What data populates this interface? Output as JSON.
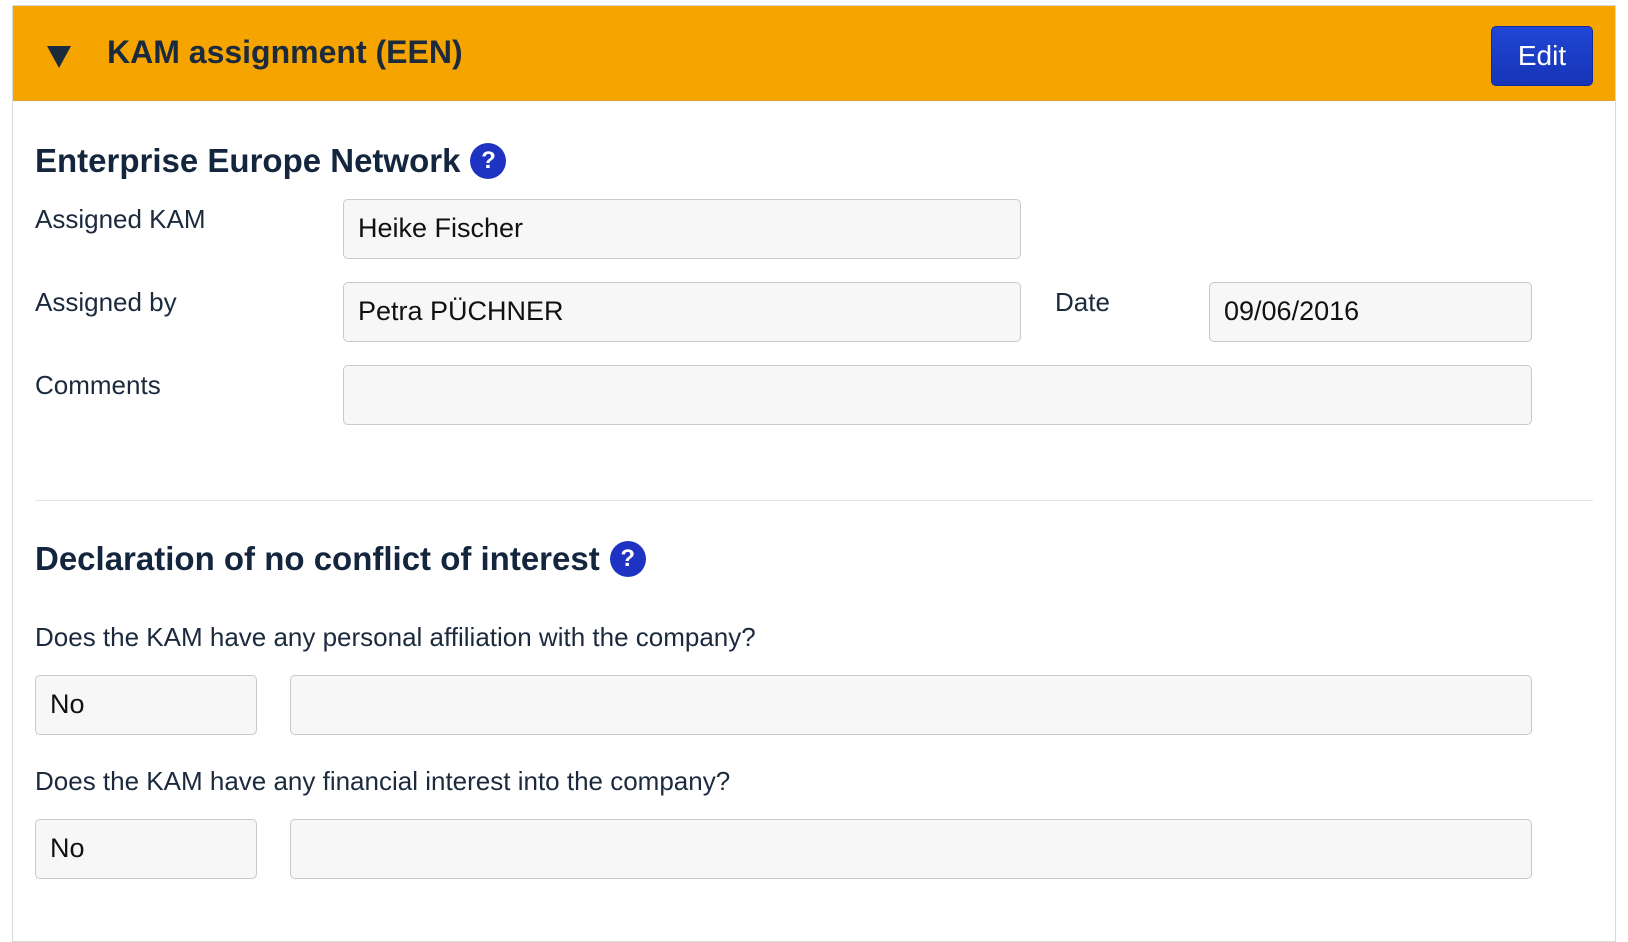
{
  "header": {
    "title": "KAM assignment (EEN)",
    "edit_label": "Edit",
    "color": "#f5a400"
  },
  "een": {
    "title": "Enterprise Europe Network",
    "help": "?",
    "assigned_kam_label": "Assigned KAM",
    "assigned_kam_value": "Heike Fischer",
    "assigned_by_label": "Assigned by",
    "assigned_by_value": "Petra PÜCHNER",
    "date_label": "Date",
    "date_value": "09/06/2016",
    "comments_label": "Comments",
    "comments_value": ""
  },
  "declaration": {
    "title": "Declaration of no conflict of interest",
    "help": "?",
    "q1": "Does the KAM have any personal affiliation with the company?",
    "q1_answer": "No",
    "q1_details": "",
    "q2": "Does the KAM have any financial interest into the company?",
    "q2_answer": "No",
    "q2_details": ""
  },
  "icons": {
    "collapse": "triangle-down-icon",
    "help": "question-circle-icon"
  },
  "colors": {
    "accent": "#f5a400",
    "button": "#1a3cc8",
    "help": "#1e33c2"
  }
}
